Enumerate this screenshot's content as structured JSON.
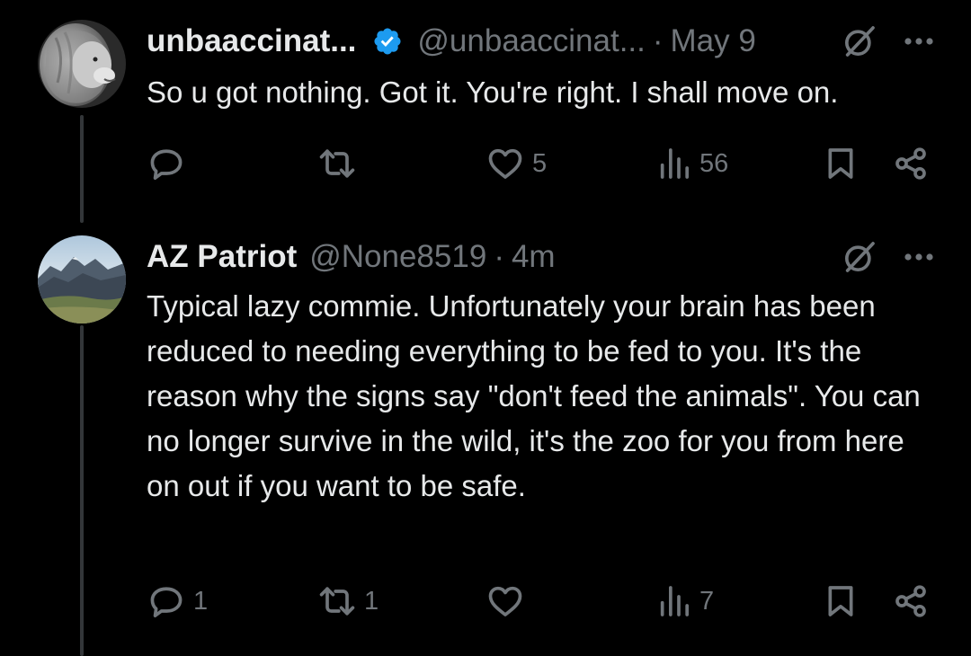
{
  "colors": {
    "background": "#000000",
    "text": "#e7e9ea",
    "secondary": "#71767b",
    "verified": "#1d9bf0",
    "thread_line": "#333639"
  },
  "posts": [
    {
      "display_name": "unbaaccinat...",
      "verified": true,
      "handle": "@unbaaccinat...",
      "separator": "·",
      "time": "May 9",
      "text": "So u got nothing. Got it. You're right. I shall move on.",
      "actions": {
        "reply_count": "",
        "repost_count": "",
        "like_count": "5",
        "view_count": "56"
      }
    },
    {
      "display_name": "AZ Patriot",
      "verified": false,
      "handle": "@None8519",
      "separator": "·",
      "time": "4m",
      "text": "Typical lazy commie. Unfortunately your brain has been reduced to needing everything to be fed to you. It's the reason why the signs say \"don't feed the animals\". You can no longer survive in the wild, it's the zoo for you from here on out if you want to be safe.",
      "actions": {
        "reply_count": "1",
        "repost_count": "1",
        "like_count": "",
        "view_count": "7"
      }
    }
  ]
}
